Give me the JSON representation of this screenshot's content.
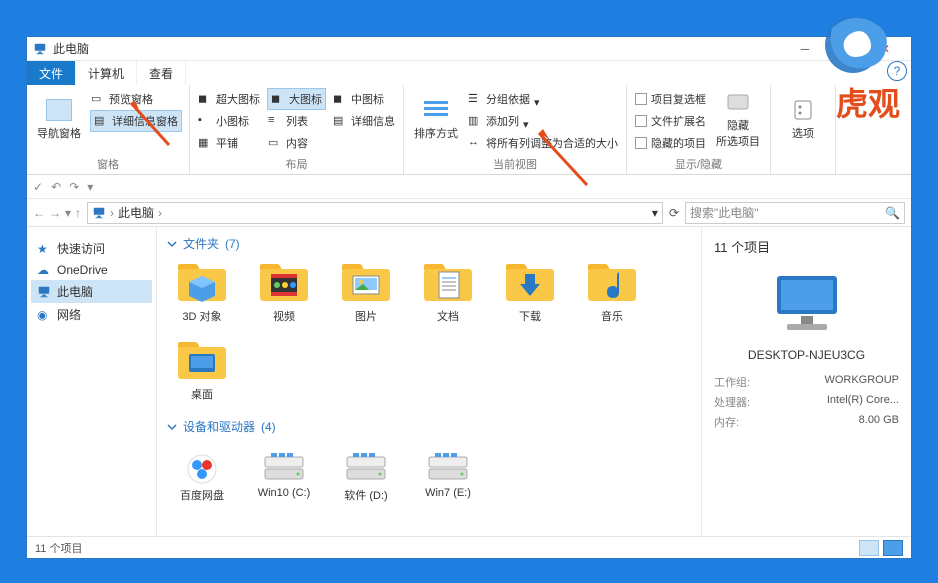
{
  "window": {
    "title": "此电脑"
  },
  "tabs": {
    "file": "文件",
    "computer": "计算机",
    "view": "查看"
  },
  "ribbon": {
    "pane": {
      "navpane": "导航窗格",
      "preview": "预览窗格",
      "details": "详细信息窗格",
      "group_label": "窗格"
    },
    "layout": {
      "extra_large": "超大图标",
      "large": "大图标",
      "medium": "中图标",
      "small": "小图标",
      "list": "列表",
      "details": "详细信息",
      "tiles": "平铺",
      "content": "内容",
      "group_label": "布局"
    },
    "current_view": {
      "sort": "排序方式",
      "group_by": "分组依据",
      "add_columns": "添加列",
      "size_all": "将所有列调整为合适的大小",
      "group_label": "当前视图"
    },
    "show_hide": {
      "checkboxes": "项目复选框",
      "extensions": "文件扩展名",
      "hidden_items": "隐藏的项目",
      "hide_selected": "隐藏\n所选项目",
      "group_label": "显示/隐藏"
    },
    "options": {
      "options": "选项"
    }
  },
  "breadcrumb": {
    "root_icon": "pc-icon",
    "item": "此电脑",
    "sep": "›"
  },
  "search": {
    "placeholder": "搜索\"此电脑\""
  },
  "nav": {
    "quick_access": "快速访问",
    "onedrive": "OneDrive",
    "this_pc": "此电脑",
    "network": "网络"
  },
  "sections": {
    "folders": {
      "label": "文件夹",
      "count": "(7)"
    },
    "devices": {
      "label": "设备和驱动器",
      "count": "(4)"
    }
  },
  "folders": [
    {
      "name": "3D 对象",
      "icon": "3d"
    },
    {
      "name": "视频",
      "icon": "video"
    },
    {
      "name": "图片",
      "icon": "pictures"
    },
    {
      "name": "文档",
      "icon": "documents"
    },
    {
      "name": "下载",
      "icon": "downloads"
    },
    {
      "name": "音乐",
      "icon": "music"
    },
    {
      "name": "桌面",
      "icon": "desktop"
    }
  ],
  "drives": [
    {
      "name": "百度网盘",
      "icon": "baidu"
    },
    {
      "name": "Win10 (C:)",
      "icon": "drive"
    },
    {
      "name": "软件 (D:)",
      "icon": "drive"
    },
    {
      "name": "Win7 (E:)",
      "icon": "drive"
    }
  ],
  "details_pane": {
    "count": "11 个项目",
    "pc_name": "DESKTOP-NJEU3CG",
    "props": [
      {
        "k": "工作组:",
        "v": "WORKGROUP"
      },
      {
        "k": "处理器:",
        "v": "Intel(R) Core..."
      },
      {
        "k": "内存:",
        "v": "8.00 GB"
      }
    ]
  },
  "status": {
    "count": "11 个项目"
  },
  "logo_text": "虎观"
}
